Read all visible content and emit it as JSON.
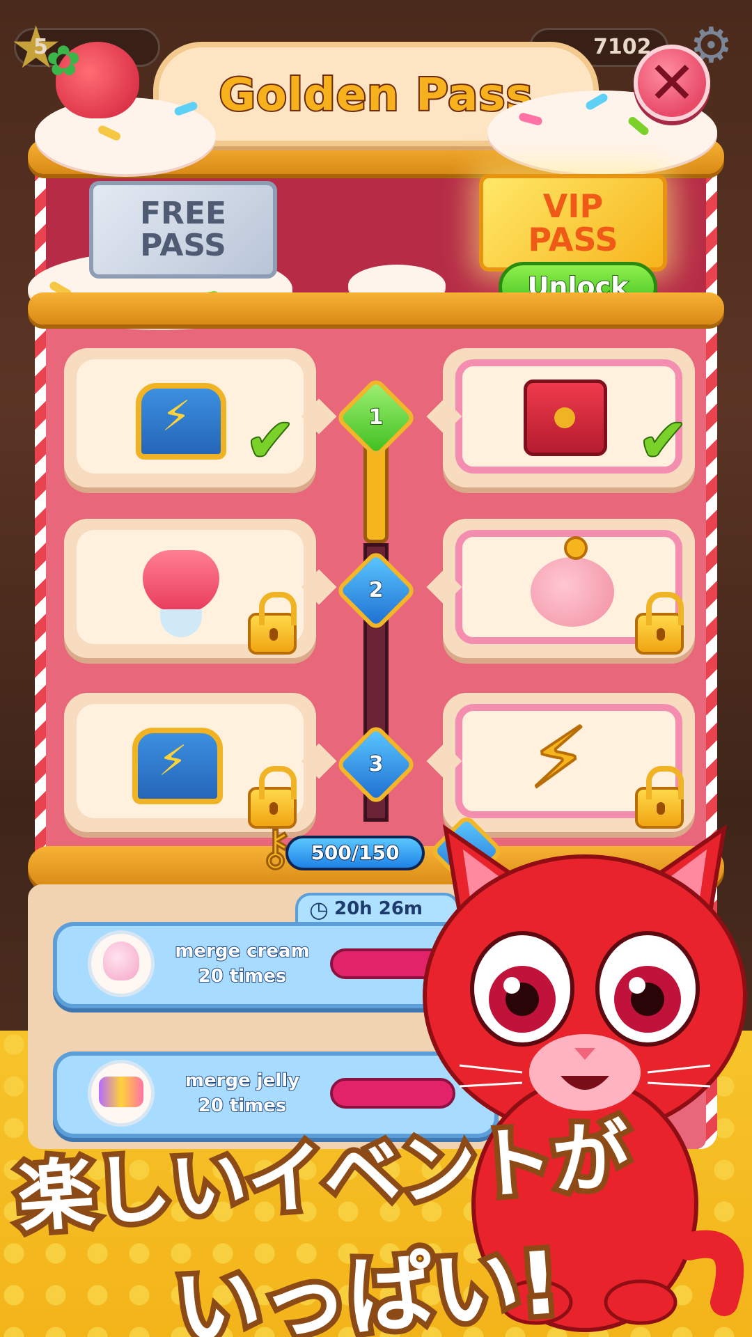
{
  "hud": {
    "level": "5",
    "gems": "7102"
  },
  "panel": {
    "title": "Golden Pass",
    "close_icon": "close-icon"
  },
  "tickets": {
    "free_line1": "FREE",
    "free_line2": "PASS",
    "vip_line1": "VIP",
    "vip_line2": "PASS",
    "unlock_label": "Unlock"
  },
  "tiers": [
    {
      "level": "1",
      "free_reward": "energy-chest-icon",
      "vip_reward": "red-chest-icon",
      "free_state": "claimed",
      "vip_state": "claimed"
    },
    {
      "level": "2",
      "free_reward": "parfait-icon",
      "vip_reward": "piggy-bank-icon",
      "free_state": "locked",
      "vip_state": "locked"
    },
    {
      "level": "3",
      "free_reward": "energy-chest-icon",
      "vip_reward": "lightning-icon",
      "free_state": "locked",
      "vip_state": "locked"
    }
  ],
  "progress": {
    "text": "500/150",
    "fill": 1.0,
    "current_level": "2"
  },
  "tasks": {
    "timer": "20h 26m",
    "items": [
      {
        "line1": "merge cream",
        "line2": "20 times",
        "icon": "cream-icon"
      },
      {
        "line1": "merge jelly",
        "line2": "20 times",
        "icon": "jelly-icon"
      }
    ]
  },
  "promo": {
    "line1": "楽しいイベントが",
    "line2": "いっぱい!"
  },
  "colors": {
    "accent_gold": "#f6b51d",
    "panel_pink": "#e8677a",
    "vip_border": "#f48eb0",
    "unlock_green": "#3fbf1f",
    "gem_blue": "#1e83e6",
    "gem_green": "#3fbf1f"
  }
}
